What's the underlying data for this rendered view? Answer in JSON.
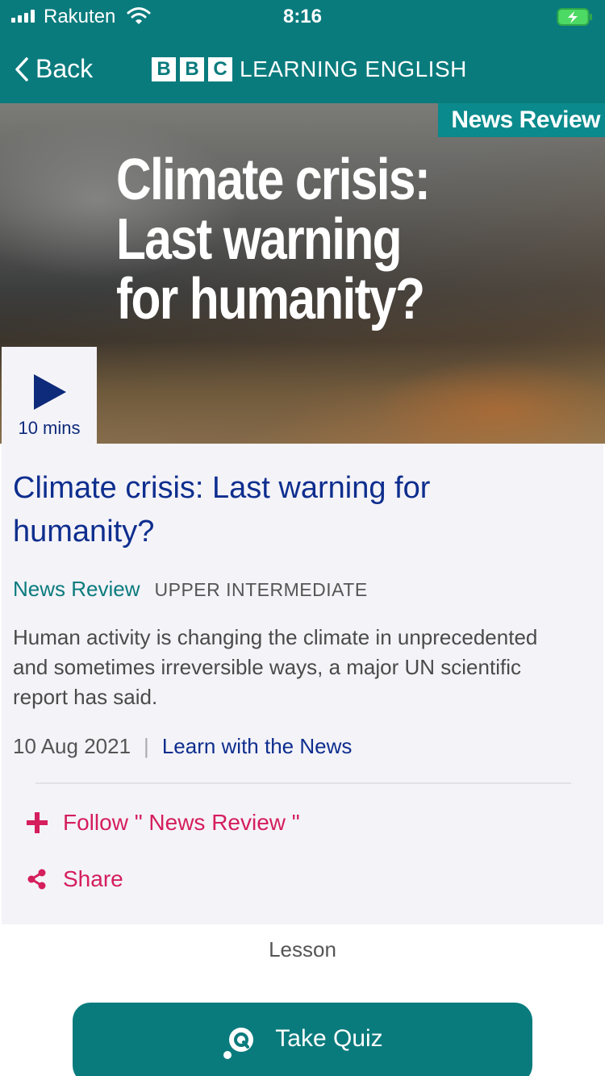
{
  "status": {
    "carrier": "Rakuten",
    "time": "8:16"
  },
  "nav": {
    "back_label": "Back",
    "logo_letters": [
      "B",
      "B",
      "C"
    ],
    "logo_text": "LEARNING ENGLISH"
  },
  "hero": {
    "tag": "News Review",
    "headline": "Climate crisis:\nLast warning\nfor humanity?",
    "duration": "10 mins"
  },
  "article": {
    "title": "Climate crisis: Last warning for humanity?",
    "series": "News Review",
    "level": "UPPER INTERMEDIATE",
    "description": "Human activity is changing the climate in unprecedented and sometimes irreversible ways, a major UN scientific report has said.",
    "date": "10 Aug 2021",
    "separator": "|",
    "collection": "Learn with the News"
  },
  "actions": {
    "follow_label": "Follow \" News Review \"",
    "share_label": "Share"
  },
  "lesson_label": "Lesson",
  "quiz_label": "Take Quiz",
  "colors": {
    "teal": "#0a7b7d",
    "navy": "#0e2e8e",
    "pink": "#d51e5c",
    "background": "#f4f3f8"
  },
  "icons": [
    "signal-icon",
    "wifi-icon",
    "battery-charging-icon",
    "chevron-left-icon",
    "play-icon",
    "plus-icon",
    "share-icon",
    "quiz-icon"
  ]
}
